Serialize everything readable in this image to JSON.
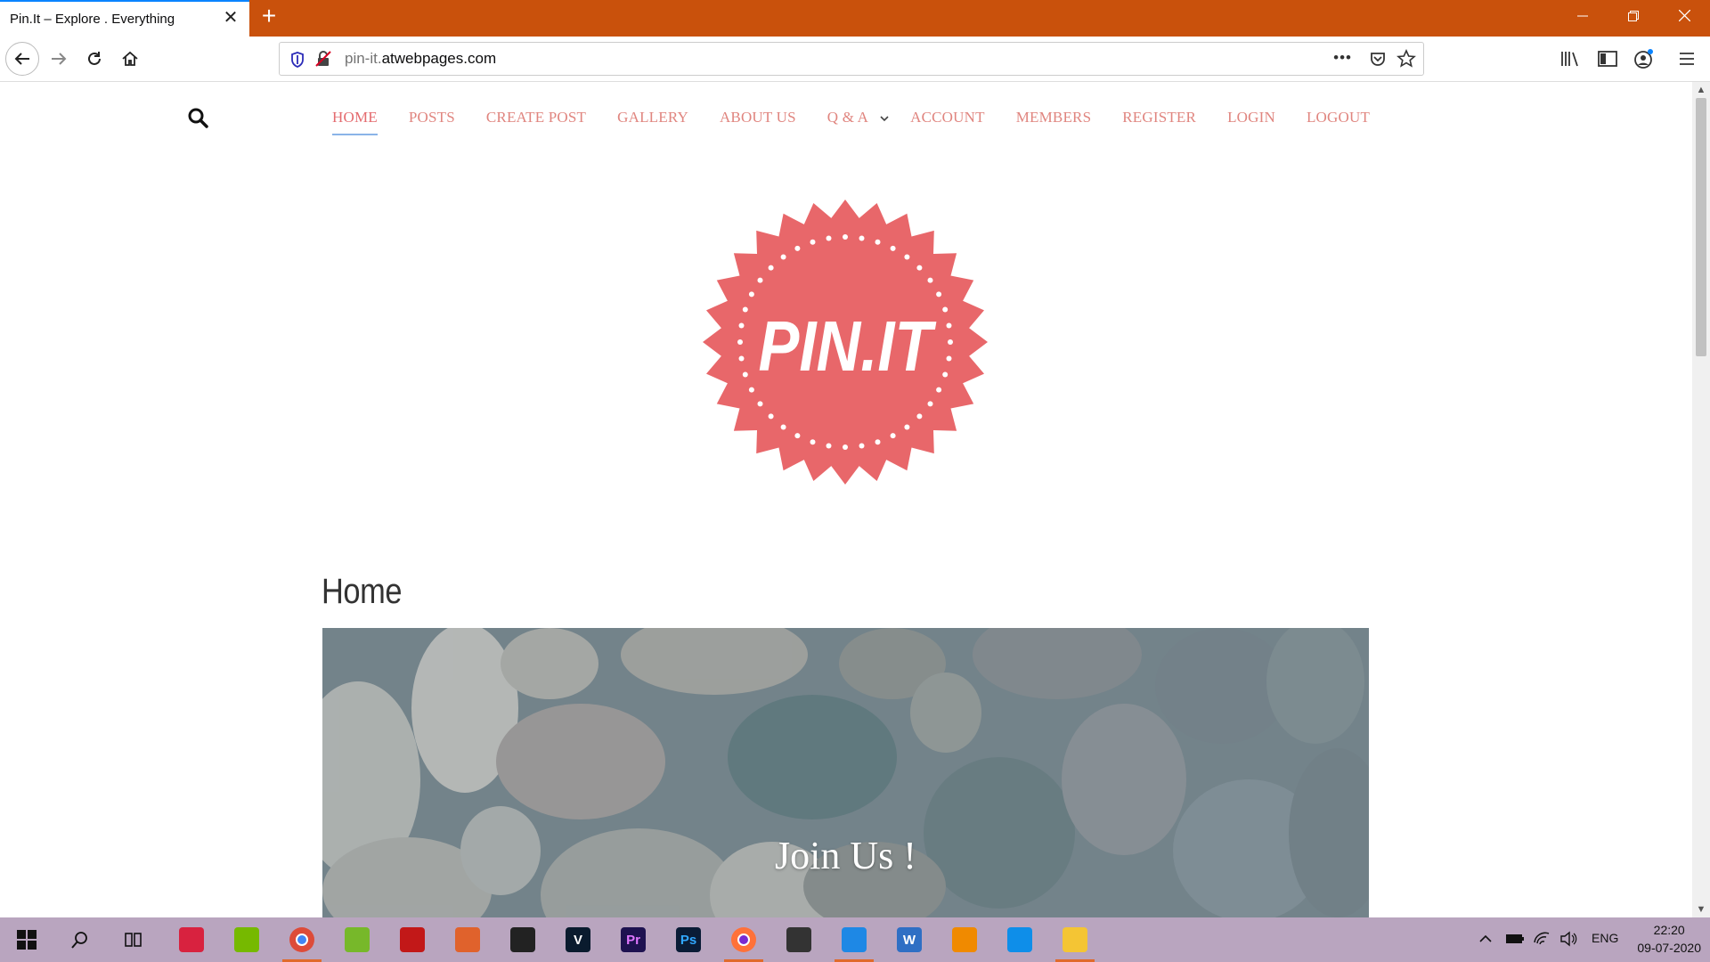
{
  "browser": {
    "tab_title": "Pin.It – Explore . Everything",
    "tab_close": "✕",
    "new_tab": "+",
    "url_prefix": "pin-it.",
    "url_domain": "atwebpages.com",
    "page_actions": "•••"
  },
  "site": {
    "menu": [
      {
        "label": "HOME",
        "active": true
      },
      {
        "label": "POSTS"
      },
      {
        "label": "CREATE POST"
      },
      {
        "label": "GALLERY"
      },
      {
        "label": "ABOUT US"
      },
      {
        "label": "Q & A",
        "has_dropdown": true
      },
      {
        "label": "ACCOUNT"
      },
      {
        "label": "MEMBERS"
      },
      {
        "label": "REGISTER"
      },
      {
        "label": "LOGIN"
      },
      {
        "label": "LOGOUT"
      }
    ],
    "logo_text": "PIN.IT",
    "page_title": "Home",
    "hero_cta": "Join Us !"
  },
  "colors": {
    "titlebar": "#c9510c",
    "accent": "#0a84ff",
    "menu_text": "#e0857f",
    "logo": "#e8676a",
    "taskbar": "#b9a5bf"
  },
  "taskbar": {
    "apps": [
      {
        "icon": "windows-start-icon",
        "running": false
      },
      {
        "icon": "search-icon",
        "running": false
      },
      {
        "icon": "task-view-icon",
        "running": false
      },
      {
        "icon": "atom-app-icon",
        "running": false
      },
      {
        "icon": "nvidia-icon",
        "running": false
      },
      {
        "icon": "chrome-icon",
        "running": true
      },
      {
        "icon": "utorrent-icon",
        "running": false
      },
      {
        "icon": "game-app-icon",
        "running": false
      },
      {
        "icon": "box-app-icon",
        "running": false
      },
      {
        "icon": "speedometer-icon",
        "running": false
      },
      {
        "icon": "vegas-icon",
        "label": "V",
        "running": false
      },
      {
        "icon": "premiere-icon",
        "label": "Pr",
        "running": false
      },
      {
        "icon": "photoshop-icon",
        "label": "Ps",
        "running": false
      },
      {
        "icon": "firefox-icon",
        "running": true
      },
      {
        "icon": "car-app-icon",
        "running": false
      },
      {
        "icon": "vscode-icon",
        "running": true
      },
      {
        "icon": "word-icon",
        "label": "W",
        "running": false
      },
      {
        "icon": "vlc-icon",
        "running": false
      },
      {
        "icon": "teamviewer-icon",
        "running": false
      },
      {
        "icon": "file-explorer-icon",
        "running": true
      }
    ],
    "language": "ENG",
    "time": "22:20",
    "date": "09-07-2020"
  }
}
